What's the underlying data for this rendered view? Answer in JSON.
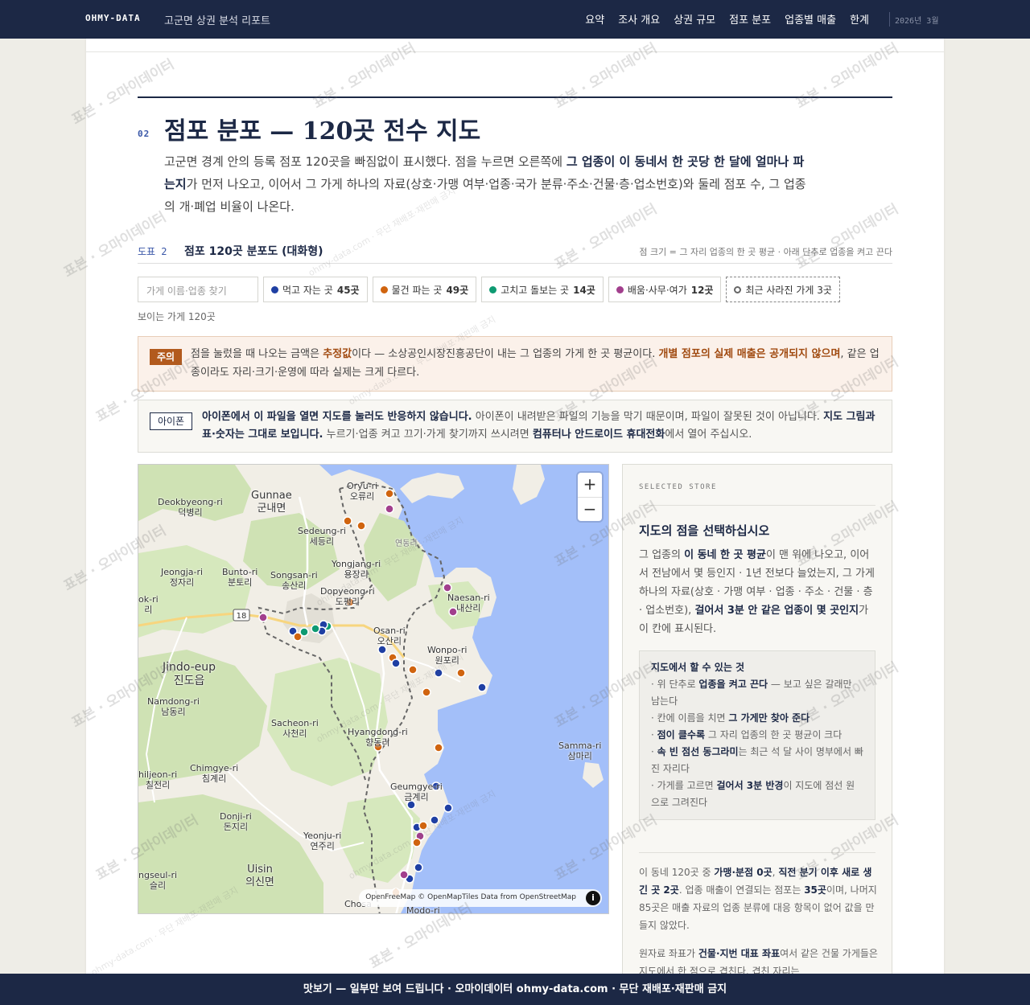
{
  "nav": {
    "brand": "OHMY-DATA",
    "report_title": "고군면 상권 분석 리포트",
    "links": [
      "요약",
      "조사 개요",
      "상권 규모",
      "점포 분포",
      "업종별 매출",
      "한계"
    ],
    "date": "2026년 3월"
  },
  "section": {
    "number": "02",
    "title": "점포 분포 — 120곳 전수 지도",
    "lead_1": "고군면 경계 안의 등록 점포 120곳을 빠짐없이 표시했다. 점을 누르면 오른쪽에 ",
    "lead_bold": "그 업종이 이 동네서 한 곳당 한 달에 얼마나 파는지",
    "lead_2": "가 먼저 나오고, 이어서 그 가게 하나의 자료(상호·가맹 여부·업종·국가 분류·주소·건물·층·업소번호)와 둘레 점포 수, 그 업종의 개·폐업 비율이 나온다."
  },
  "figure": {
    "label": "도표 2",
    "title": "점포 120곳 분포도 (대화형)",
    "note": "점 크기 = 그 자리 업종의 한 곳 평균 · 아래 단추로 업종을 켜고 끈다"
  },
  "filters": {
    "search_placeholder": "가게 이름·업종 찾기",
    "chips": [
      {
        "label": "먹고 자는 곳",
        "count": "45곳",
        "color": "#1f3fa3"
      },
      {
        "label": "물건 파는 곳",
        "count": "49곳",
        "color": "#d0640f"
      },
      {
        "label": "고치고 돌보는 곳",
        "count": "14곳",
        "color": "#0e9a72"
      },
      {
        "label": "배움·사무·여가",
        "count": "12곳",
        "color": "#a23f8d"
      }
    ],
    "closed_chip": "최근 사라진 가게 3곳",
    "visible_count": "보이는 가게 120곳"
  },
  "notice": {
    "tag": "주의",
    "t1": "점을 눌렀을 때 나오는 금액은 ",
    "b1": "추정값",
    "t2": "이다 — 소상공인시장진흥공단이 내는 그 업종의 가게 한 곳 평균이다. ",
    "b2": "개별 점포의 실제 매출은 공개되지 않으며",
    "t3": ", 같은 업종이라도 자리·크기·운영에 따라 실제는 크게 다르다."
  },
  "ios": {
    "tag": "아이폰",
    "b1": "아이폰에서 이 파일을 열면 지도를 눌러도 반응하지 않습니다.",
    "t1": " 아이폰이 내려받은 파일의 기능을 막기 때문이며, 파일이 잘못된 것이 아닙니다. ",
    "b2": "지도 그림과 표·숫자는 그대로 보입니다.",
    "t2": " 누르기·업종 켜고 끄기·가게 찾기까지 쓰시려면 ",
    "b3": "컴퓨터나 안드로이드 휴대전화",
    "t3": "에서 열어 주십시오."
  },
  "map": {
    "zoom_in": "+",
    "zoom_out": "−",
    "attribution": "OpenFreeMap © OpenMapTiles Data from OpenStreetMap",
    "info": "i",
    "route": "18",
    "places": [
      {
        "en": "Gunnae",
        "ko": "군내면"
      },
      {
        "en": "Deokbyeong-ri",
        "ko": "덕병리"
      },
      {
        "en": "Oryu-ri",
        "ko": "오류리"
      },
      {
        "en": "Sedeung-ri",
        "ko": "세등리"
      },
      {
        "en": "Yongjang-ri",
        "ko": "용장리"
      },
      {
        "en": "Jeongja-ri",
        "ko": "정자리"
      },
      {
        "en": "Bunto-ri",
        "ko": "분토리"
      },
      {
        "en": "Songsan-ri",
        "ko": "송산리"
      },
      {
        "en": "Dopyeong-ri",
        "ko": "도평리"
      },
      {
        "en": "Naesan-ri",
        "ko": "내산리"
      },
      {
        "en": "Osan-ri",
        "ko": "오산리"
      },
      {
        "en": "Wonpo-ri",
        "ko": "원포리"
      },
      {
        "en": "Jindo-eup",
        "ko": "진도읍"
      },
      {
        "en": "Namdong-ri",
        "ko": "남동리"
      },
      {
        "en": "Sacheon-ri",
        "ko": "사천리"
      },
      {
        "en": "Hyangdong-ri",
        "ko": "향동리"
      },
      {
        "en": "Samma-ri",
        "ko": "삼마리"
      },
      {
        "en": "Chimgye-ri",
        "ko": "침계리"
      },
      {
        "en": "hiljeon-ri",
        "ko": "칠전리"
      },
      {
        "en": "Geumgye-ri",
        "ko": "금계리"
      },
      {
        "en": "Donji-ri",
        "ko": "돈지리"
      },
      {
        "en": "Yeonju-ri",
        "ko": "연주리"
      },
      {
        "en": "Uisin",
        "ko": "의신면"
      },
      {
        "en": "ngseul-ri",
        "ko": "슬리"
      },
      {
        "en": "ok-ri",
        "ko": "리"
      },
      {
        "en": "Chosa",
        "ko": ""
      },
      {
        "en": "Modo-ri",
        "ko": ""
      },
      {
        "en": "",
        "ko": "연동리"
      }
    ]
  },
  "side": {
    "kicker": "SELECTED STORE",
    "title": "지도의 점을 선택하십시오",
    "p1": "그 업종의 ",
    "b1": "이 동네 한 곳 평균",
    "p2": "이 맨 위에 나오고, 이어서 전남에서 몇 등인지 · 1년 전보다 늘었는지, 그 가게 하나의 자료(상호 · 가맹 여부 · 업종 · 주소 · 건물 · 층 · 업소번호), ",
    "b2": "걸어서 3분 안 같은 업종이 몇 곳인지",
    "p3": "가 이 칸에 표시된다.",
    "howto_title": "지도에서 할 수 있는 것",
    "h1a": "· 위 단추로 ",
    "h1b": "업종을 켜고 끈다",
    "h1c": " — 보고 싶은 갈래만 남는다",
    "h2a": "· 칸에 이름을 치면 ",
    "h2b": "그 가게만 찾아 준다",
    "h3a": "· ",
    "h3b": "점이 클수록",
    "h3c": " 그 자리 업종의 한 곳 평균이 크다",
    "h4a": "· ",
    "h4b": "속 빈 점선 동그라미",
    "h4c": "는 최근 석 달 사이 명부에서 빠진 자리다",
    "h5a": "· 가게를 고르면 ",
    "h5b": "걸어서 3분 반경",
    "h5c": "이 지도에 점선 원으로 그려진다",
    "s1": "이 동네 120곳 중 ",
    "sb1": "가맹·분점 0곳",
    "s2": ", ",
    "sb2": "직전 분기 이후 새로 생긴 곳 2곳",
    "s3": ". 업종 매출이 연결되는 점포는 ",
    "sb3": "35곳",
    "s4": "이며, 나머지 85곳은 매출 자료의 업종 분류에 대응 항목이 없어 값을 만들지 않았다.",
    "r1": "원자료 좌표가 ",
    "rb1": "건물·지번 대표 좌표",
    "r2": "여서 같은 건물 가게들은 지도에서 한 점으로 겹친다. 겹친 자리는"
  },
  "watermark": {
    "main": "표본 · 오마이데이터",
    "sub": "ohmy-data.com · 무단 재배포·재판매 금지"
  },
  "bottombar": "맛보기 — 일부만 보여 드립니다 · 오마이데이터 ohmy-data.com · 무단 재배포·재판매 금지"
}
